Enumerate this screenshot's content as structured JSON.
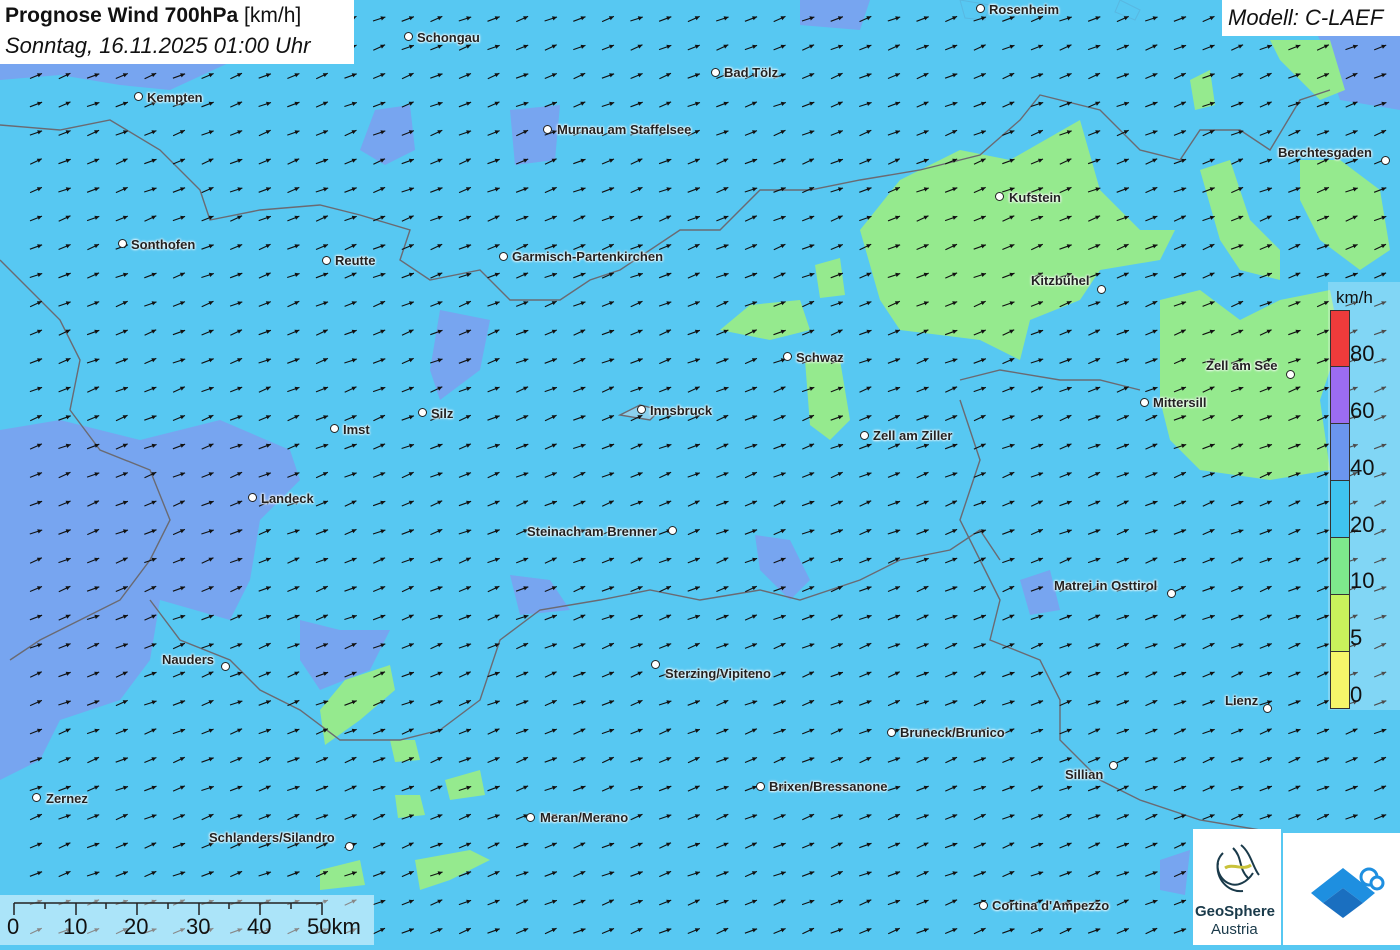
{
  "header": {
    "title_bold": "Prognose Wind 700hPa",
    "title_unit": "[km/h]",
    "subtitle": "Sonntag, 16.11.2025 01:00 Uhr",
    "model": "Modell: C-LAEF"
  },
  "legend": {
    "unit": "km/h",
    "segments": [
      {
        "color": "#ee3b3b"
      },
      {
        "color": "#9b6cf2"
      },
      {
        "color": "#6b95ee"
      },
      {
        "color": "#3fc4f0"
      },
      {
        "color": "#7ee88c"
      },
      {
        "color": "#c8f25c"
      },
      {
        "color": "#f6f66a"
      }
    ],
    "labels": [
      "80",
      "60",
      "40",
      "20",
      "10",
      "5",
      "0"
    ]
  },
  "scale": {
    "labels": [
      "0",
      "10",
      "20",
      "30",
      "40",
      "50km"
    ]
  },
  "logos": {
    "geosphere_line1": "GeoSphere",
    "geosphere_line2": "Austria",
    "geosphere_icon": "geosphere-logo-icon",
    "right_icon": "weather-logo-icon"
  },
  "cities": [
    {
      "name": "Rosenheim",
      "side": "right"
    },
    {
      "name": "Schongau",
      "side": "right"
    },
    {
      "name": "Bad Tölz",
      "side": "right"
    },
    {
      "name": "Kempten",
      "side": "right"
    },
    {
      "name": "Murnau am Staffelsee",
      "side": "right"
    },
    {
      "name": "Berchtesgaden",
      "side": "left"
    },
    {
      "name": "Kufstein",
      "side": "right"
    },
    {
      "name": "Sonthofen",
      "side": "right"
    },
    {
      "name": "Reutte",
      "side": "right"
    },
    {
      "name": "Garmisch-Partenkirchen",
      "side": "right"
    },
    {
      "name": "Kitzbühel",
      "side": "left"
    },
    {
      "name": "Schwaz",
      "side": "right"
    },
    {
      "name": "Zell am See",
      "side": "left"
    },
    {
      "name": "Mittersill",
      "side": "right"
    },
    {
      "name": "Silz",
      "side": "right"
    },
    {
      "name": "Innsbruck",
      "side": "right"
    },
    {
      "name": "Imst",
      "side": "right"
    },
    {
      "name": "Zell am Ziller",
      "side": "right"
    },
    {
      "name": "Landeck",
      "side": "right"
    },
    {
      "name": "Steinach am Brenner",
      "side": "left"
    },
    {
      "name": "Matrei in Osttirol",
      "side": "left"
    },
    {
      "name": "Nauders",
      "side": "left"
    },
    {
      "name": "Sterzing/Vipiteno",
      "side": "right"
    },
    {
      "name": "Lienz",
      "side": "left"
    },
    {
      "name": "Bruneck/Brunico",
      "side": "right"
    },
    {
      "name": "Sillian",
      "side": "left"
    },
    {
      "name": "Brixen/Bressanone",
      "side": "right"
    },
    {
      "name": "Zernez",
      "side": "right"
    },
    {
      "name": "Meran/Merano",
      "side": "right"
    },
    {
      "name": "Schlanders/Silandro",
      "side": "left"
    },
    {
      "name": "Cortina d'Ampezzo",
      "side": "right"
    }
  ],
  "wind": {
    "direction": "from south-west (arrows pointing north-east)",
    "dominant_speed_class": "20-40 km/h"
  }
}
